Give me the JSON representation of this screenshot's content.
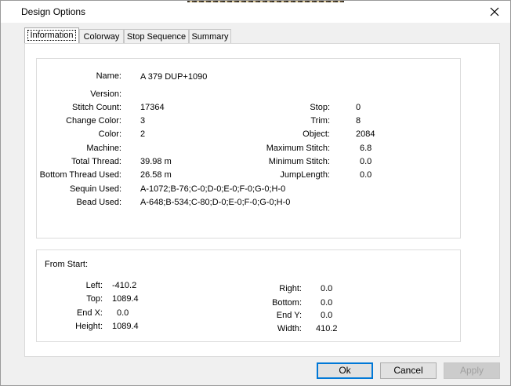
{
  "window": {
    "title": "Design Options"
  },
  "tabs": [
    {
      "label": "Information"
    },
    {
      "label": "Colorway"
    },
    {
      "label": "Stop Sequence"
    },
    {
      "label": "Summary"
    }
  ],
  "info": {
    "name": {
      "label": "Name:",
      "value": "A 379 DUP+1090"
    },
    "version": {
      "label": "Version:",
      "value": ""
    },
    "stitch_count": {
      "label": "Stitch Count:",
      "value": "17364"
    },
    "change_color": {
      "label": "Change Color:",
      "value": "3"
    },
    "color": {
      "label": "Color:",
      "value": "2"
    },
    "machine": {
      "label": "Machine:",
      "value": ""
    },
    "total_thread": {
      "label": "Total Thread:",
      "value": "39.98 m"
    },
    "bottom_thread": {
      "label": "Bottom Thread Used:",
      "value": "26.58 m"
    },
    "sequin_used": {
      "label": "Sequin Used:",
      "value": "A-1072;B-76;C-0;D-0;E-0;F-0;G-0;H-0"
    },
    "bead_used": {
      "label": "Bead Used:",
      "value": "A-648;B-534;C-80;D-0;E-0;F-0;G-0;H-0"
    },
    "stop": {
      "label": "Stop:",
      "value": "0"
    },
    "trim": {
      "label": "Trim:",
      "value": "8"
    },
    "object": {
      "label": "Object:",
      "value": "2084"
    },
    "max_stitch": {
      "label": "Maximum Stitch:",
      "value": "6.8"
    },
    "min_stitch": {
      "label": "Minimum Stitch:",
      "value": "0.0"
    },
    "jump_length": {
      "label": "JumpLength:",
      "value": "0.0"
    }
  },
  "from_start": {
    "title": "From Start:",
    "left": {
      "label": "Left:",
      "value": "-410.2"
    },
    "top": {
      "label": "Top:",
      "value": "1089.4"
    },
    "end_x": {
      "label": "End X:",
      "value": "0.0"
    },
    "height": {
      "label": "Height:",
      "value": "1089.4"
    },
    "right": {
      "label": "Right:",
      "value": "0.0"
    },
    "bottom": {
      "label": "Bottom:",
      "value": "0.0"
    },
    "end_y": {
      "label": "End Y:",
      "value": "0.0"
    },
    "width": {
      "label": "Width:",
      "value": "410.2"
    }
  },
  "buttons": {
    "ok": "Ok",
    "cancel": "Cancel",
    "apply": "Apply"
  },
  "icons": {
    "close": "close-icon"
  }
}
